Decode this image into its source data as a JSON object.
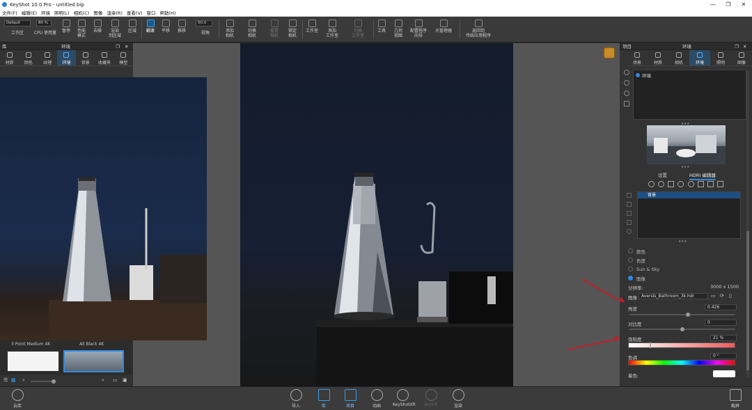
{
  "window": {
    "title": "KeyShot 10.0 Pro  - untitled.bip",
    "minimize": "—",
    "maximize": "❐",
    "close": "✕"
  },
  "menu": [
    "文件(F)",
    "编辑(E)",
    "环境",
    "照明(L)",
    "相机(C)",
    "图像",
    "渲染(R)",
    "查看(V)",
    "窗口",
    "帮助(H)"
  ],
  "toolbar": {
    "workspace_value": "Default",
    "workspace_label": "工作区",
    "cpu_value": "80 %",
    "cpu_label": "CPU 使用量",
    "pause": "暂停",
    "perf_label": "性能\n模式",
    "denoise": "去噪",
    "region_render": "渲染\n到区域",
    "region": "区域",
    "tumble": "翻滚",
    "pan": "平移",
    "dolly": "推移",
    "fov_value": "50.0",
    "fov_label": "视角",
    "add_camera": "添加\n相机",
    "switch_camera": "切换\n相机",
    "reset_camera": "重置\n相机",
    "lock_camera": "锁定\n相机",
    "studio": "工作室",
    "add_studio": "添加\n工作室",
    "switch_studio": "切换\n工作室",
    "tools": "工具",
    "geometry_view": "几何\n视图",
    "config_wizard": "配置程序\n向导",
    "light_manager": "光管理器",
    "back_to_legacy": "返回到\n传统应用程序"
  },
  "left_panel": {
    "title_left": "库",
    "title": "环境",
    "tabs": [
      "材质",
      "颜色",
      "纹理",
      "环境",
      "背景",
      "收藏夹",
      "模型"
    ],
    "selected_tab": "环境",
    "thumbnails": [
      "3 Point Medium 4K",
      "All Black 4K"
    ]
  },
  "right_panel": {
    "title_left": "项目",
    "title": "环境",
    "tabs": [
      "场景",
      "材质",
      "相机",
      "环境",
      "照明",
      "图像"
    ],
    "selected_tab": "环境",
    "env_item": "环境",
    "subtabs": [
      "设置",
      "HDRI 编辑器"
    ],
    "selected_subtab": "HDRI 编辑器",
    "bg_item": "背景",
    "radio": [
      {
        "label": "颜色",
        "on": false
      },
      {
        "label": "色度",
        "on": false
      },
      {
        "label": "Sun & Sky",
        "on": false
      },
      {
        "label": "图像",
        "on": true
      }
    ],
    "resolution_label": "分辨率:",
    "resolution_value": "3000 x 1500",
    "image_label": "图像",
    "image_value": "Aversis_Bathroom_3k.hdr",
    "brightness_label": "亮度",
    "brightness_value": "0.426",
    "brightness_level": 0.55,
    "contrast_label": "对比度",
    "contrast_value": "0",
    "contrast_level": 0.5,
    "saturation_label": "饱和度",
    "saturation_value": "21 %",
    "hue_label": "色调",
    "hue_value": "0 °",
    "overlay_label": "着色:"
  },
  "bottom": {
    "cloud_library": "云库",
    "import": "导入",
    "library": "库",
    "project": "项目",
    "animation": "动画",
    "keyshotxr": "KeyShotXR",
    "keyvr": "KeyVR",
    "render": "渲染",
    "screenshot": "截屏"
  },
  "colors": {
    "accent": "#2f88e0",
    "arrow": "#c0202a"
  }
}
